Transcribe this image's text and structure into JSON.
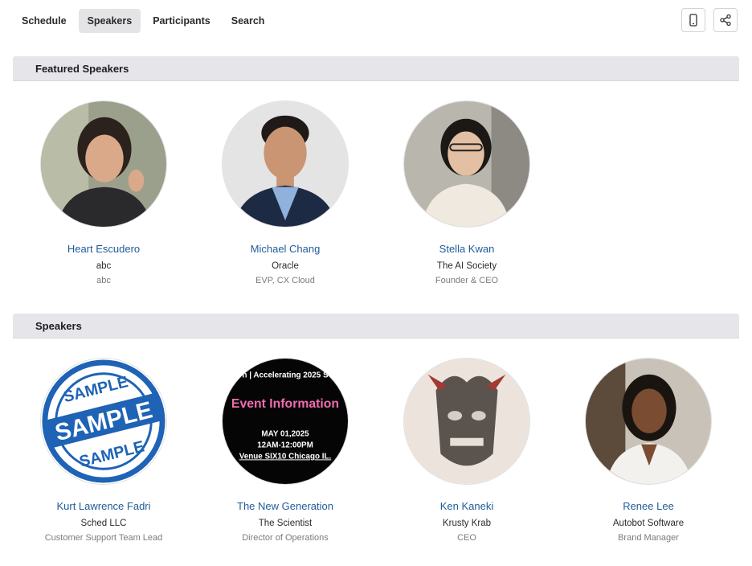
{
  "tabs": [
    {
      "label": "Schedule",
      "active": false
    },
    {
      "label": "Speakers",
      "active": true
    },
    {
      "label": "Participants",
      "active": false
    },
    {
      "label": "Search",
      "active": false
    }
  ],
  "toolbar": {
    "mobile_icon": "mobile-phone-icon",
    "share_icon": "share-icon"
  },
  "featured": {
    "title": "Featured Speakers",
    "speakers": [
      {
        "name": "Heart Escudero",
        "company": "abc",
        "role": "abc"
      },
      {
        "name": "Michael Chang",
        "company": "Oracle",
        "role": "EVP, CX Cloud"
      },
      {
        "name": "Stella Kwan",
        "company": "The AI Society",
        "role": "Founder & CEO"
      }
    ]
  },
  "speakers": {
    "title": "Speakers",
    "speakers": [
      {
        "name": "Kurt Lawrence Fadri",
        "company": "Sched LLC",
        "role": "Customer Support Team Lead"
      },
      {
        "name": "The New Generation",
        "company": "The Scientist",
        "role": "Director of Operations"
      },
      {
        "name": "Ken Kaneki",
        "company": "Krusty Krab",
        "role": "CEO"
      },
      {
        "name": "Renee Lee",
        "company": "Autobot Software",
        "role": "Brand Manager"
      }
    ]
  },
  "images": {
    "sample_stamp": {
      "top": "SAMPLE",
      "middle": "SAMPLE",
      "bottom": "SAMPLE"
    },
    "event_poster": {
      "banner": "n | Accelerating 2025 S",
      "heading": "Event Information",
      "date": "MAY 01,2025",
      "time": "12AM-12:00PM",
      "venue": "Venue SIX10 Chicago IL."
    }
  },
  "colors": {
    "link": "#1f5c99",
    "header_bg": "#e6e6ea",
    "stamp_blue": "#1e63b5",
    "poster_pink": "#f06bb0"
  }
}
